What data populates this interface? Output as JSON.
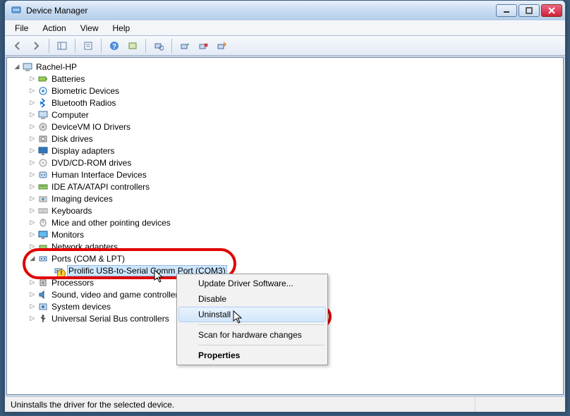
{
  "window": {
    "title": "Device Manager"
  },
  "menu": {
    "file": "File",
    "action": "Action",
    "view": "View",
    "help": "Help"
  },
  "root": {
    "name": "Rachel-HP"
  },
  "categories": [
    {
      "label": "Batteries",
      "icon": "battery"
    },
    {
      "label": "Biometric Devices",
      "icon": "biometric"
    },
    {
      "label": "Bluetooth Radios",
      "icon": "bluetooth"
    },
    {
      "label": "Computer",
      "icon": "computer"
    },
    {
      "label": "DeviceVM IO Drivers",
      "icon": "driver"
    },
    {
      "label": "Disk drives",
      "icon": "disk"
    },
    {
      "label": "Display adapters",
      "icon": "display"
    },
    {
      "label": "DVD/CD-ROM drives",
      "icon": "cdrom"
    },
    {
      "label": "Human Interface Devices",
      "icon": "hid"
    },
    {
      "label": "IDE ATA/ATAPI controllers",
      "icon": "ide"
    },
    {
      "label": "Imaging devices",
      "icon": "imaging"
    },
    {
      "label": "Keyboards",
      "icon": "keyboard"
    },
    {
      "label": "Mice and other pointing devices",
      "icon": "mouse"
    },
    {
      "label": "Monitors",
      "icon": "monitor"
    },
    {
      "label": "Network adapters",
      "icon": "network"
    },
    {
      "label": "Ports (COM & LPT)",
      "icon": "port",
      "expanded": true,
      "children": [
        {
          "label": "Prolific USB-to-Serial Comm Port (COM3)",
          "icon": "port",
          "warning": true,
          "selected": true
        }
      ]
    },
    {
      "label": "Processors",
      "icon": "cpu"
    },
    {
      "label": "Sound, video and game controllers",
      "icon": "sound"
    },
    {
      "label": "System devices",
      "icon": "system"
    },
    {
      "label": "Universal Serial Bus controllers",
      "icon": "usb"
    }
  ],
  "context_menu": {
    "update": "Update Driver Software...",
    "disable": "Disable",
    "uninstall": "Uninstall",
    "scan": "Scan for hardware changes",
    "properties": "Properties"
  },
  "statusbar": {
    "text": "Uninstalls the driver for the selected device."
  }
}
